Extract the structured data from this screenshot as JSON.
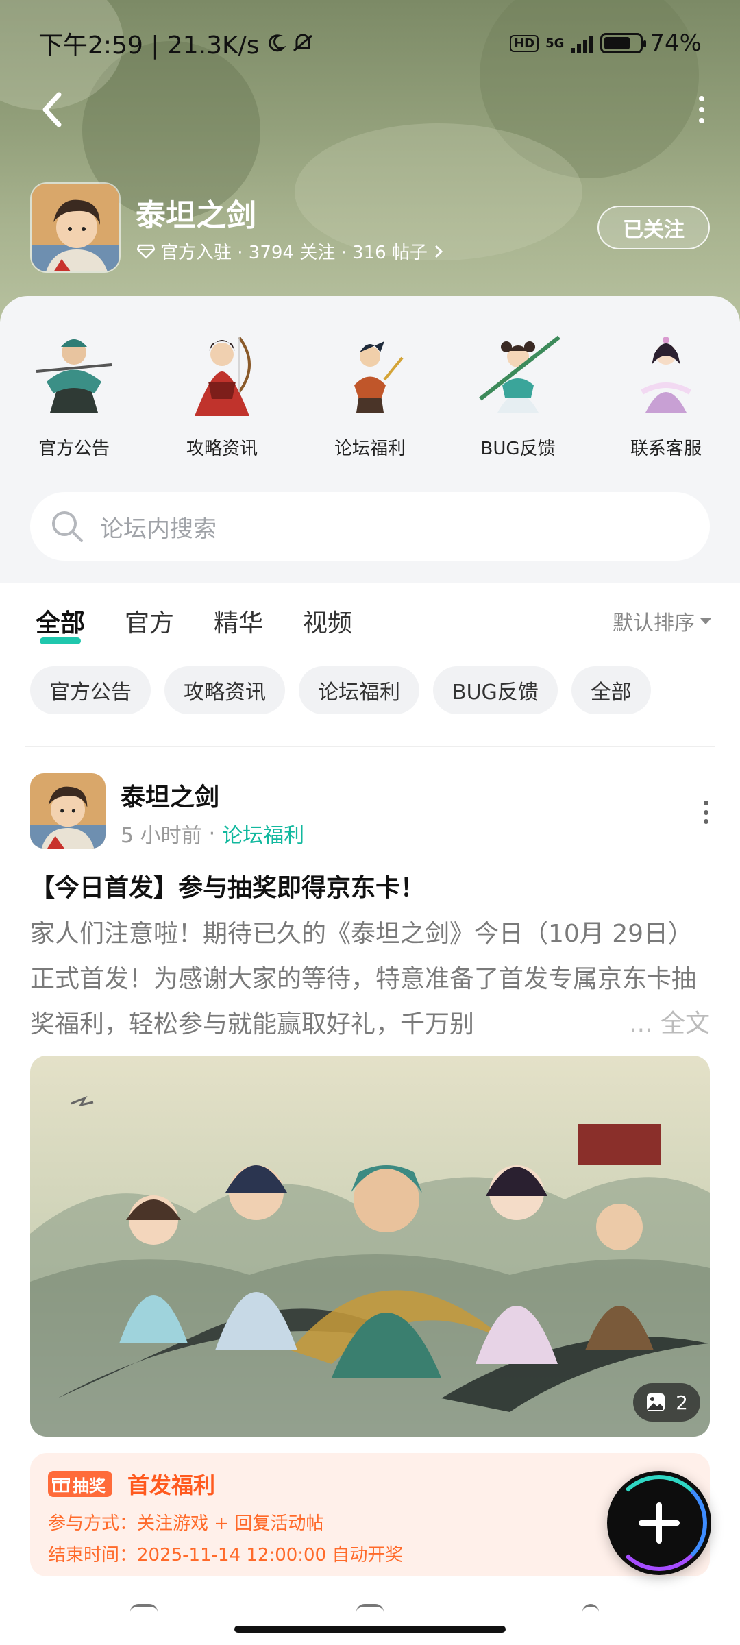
{
  "status_bar": {
    "time_speed": "下午2:59 | 21.3K/s",
    "hd": "HD",
    "network": "5G",
    "battery": "74%",
    "battery_level": 0.74
  },
  "header": {
    "game_name": "泰坦之剑",
    "meta": "官方入驻 · 3794 关注 · 316 帖子",
    "follow_label": "已关注"
  },
  "categories": [
    {
      "label": "官方公告",
      "icon": "warrior-figure"
    },
    {
      "label": "攻略资讯",
      "icon": "archer-figure"
    },
    {
      "label": "论坛福利",
      "icon": "swordsman-figure"
    },
    {
      "label": "BUG反馈",
      "icon": "spear-girl-figure"
    },
    {
      "label": "联系客服",
      "icon": "lady-figure"
    }
  ],
  "search": {
    "placeholder": "论坛内搜索"
  },
  "tabs": [
    {
      "label": "全部",
      "active": true
    },
    {
      "label": "官方",
      "active": false
    },
    {
      "label": "精华",
      "active": false
    },
    {
      "label": "视频",
      "active": false
    }
  ],
  "sort_label": "默认排序",
  "chips": [
    "官方公告",
    "攻略资讯",
    "论坛福利",
    "BUG反馈",
    "全部"
  ],
  "post": {
    "author": "泰坦之剑",
    "time": "5 小时前",
    "separator": "·",
    "category": "论坛福利",
    "title": "【今日首发】参与抽奖即得京东卡！",
    "body": "家人们注意啦！期待已久的《泰坦之剑》今日（10月 29日）正式首发！为感谢大家的等待，特意准备了首发专属京东卡抽奖福利，轻松参与就能赢取好礼，千万别",
    "more_label": "... 全文",
    "image_count": "2"
  },
  "lottery": {
    "badge": "抽奖",
    "title": "首发福利",
    "method": "参与方式：关注游戏 + 回复活动帖",
    "end_time": "结束时间：2025-11-14 12:00:00 自动开奖"
  },
  "colors": {
    "accent": "#1fc7ad",
    "link": "#12b89e",
    "lottery_orange": "#ff5a1f",
    "lottery_bg": "#fff0ea"
  }
}
